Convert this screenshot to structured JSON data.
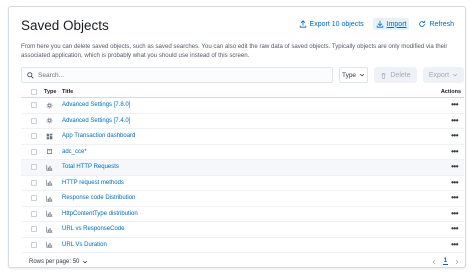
{
  "header": {
    "title": "Saved Objects",
    "export_label": "Export 10 objects",
    "import_label": "Import",
    "refresh_label": "Refresh"
  },
  "description": "From here you can delete saved objects, such as saved searches. You can also edit the raw data of saved objects. Typically objects are only modified via their associated application, which is probably what you should use instead of this screen.",
  "toolbar": {
    "search_placeholder": "Search...",
    "type_label": "Type",
    "delete_label": "Delete",
    "export_label": "Export"
  },
  "table": {
    "columns": {
      "type": "Type",
      "title": "Title",
      "actions": "Actions"
    },
    "rows": [
      {
        "title": "Advanced Settings [7.8.0]",
        "icon": "gear-icon"
      },
      {
        "title": "Advanced Settings [7.4.0]",
        "icon": "gear-icon"
      },
      {
        "title": "App Transaction dashboard",
        "icon": "dashboard-icon"
      },
      {
        "title": "adc_cce*",
        "icon": "index-pattern-icon"
      },
      {
        "title": "Total HTTP Requests",
        "icon": "visualization-icon"
      },
      {
        "title": "HTTP request methods",
        "icon": "visualization-icon"
      },
      {
        "title": "Response code Distribution",
        "icon": "visualization-icon"
      },
      {
        "title": "HttpContentType distribution",
        "icon": "visualization-icon"
      },
      {
        "title": "URL vs ResponseCode",
        "icon": "visualization-icon"
      },
      {
        "title": "URL Vs Duration",
        "icon": "visualization-icon"
      }
    ]
  },
  "footer": {
    "rows_per_page": "Rows per page: 50",
    "current_page": "1"
  },
  "colors": {
    "link": "#006bb8",
    "border": "#d3dae6"
  }
}
